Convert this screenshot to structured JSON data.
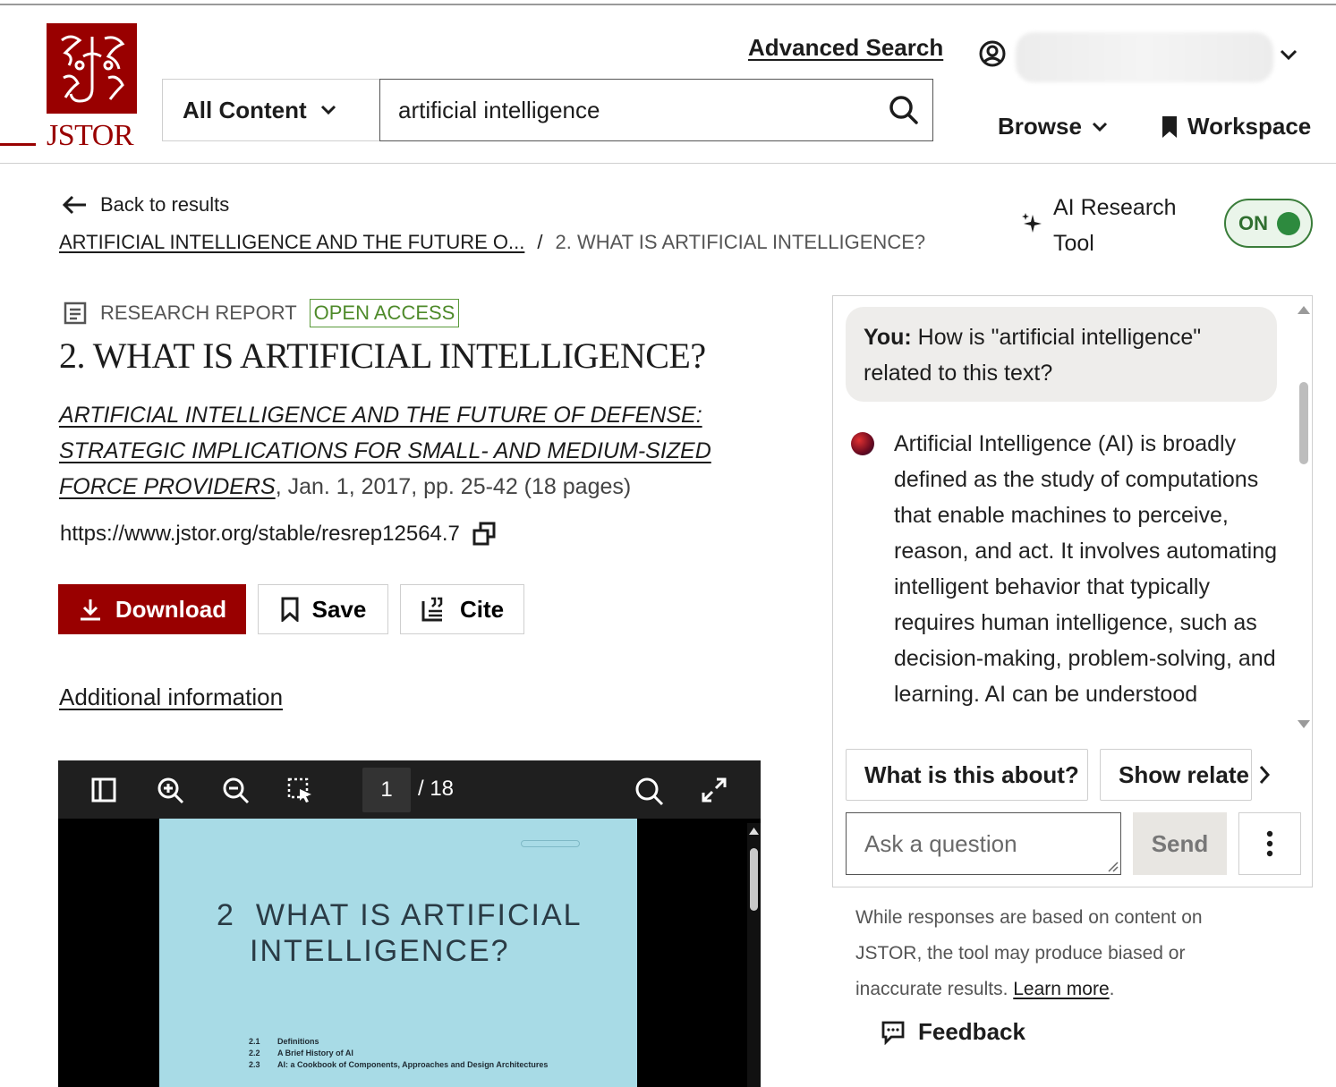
{
  "header": {
    "logo_text": "JSTOR",
    "advanced_search": "Advanced Search",
    "content_filter": "All Content",
    "search_value": "artificial intelligence",
    "browse": "Browse",
    "workspace": "Workspace"
  },
  "nav": {
    "back": "Back to results",
    "breadcrumb_parent": "ARTIFICIAL INTELLIGENCE AND THE FUTURE O...",
    "breadcrumb_sep": "/",
    "breadcrumb_current": "2. WHAT IS ARTIFICIAL INTELLIGENCE?"
  },
  "ai_tool": {
    "label_line1": "AI Research",
    "label_line2": "Tool",
    "toggle": "ON"
  },
  "article": {
    "type": "RESEARCH REPORT",
    "access": "OPEN ACCESS",
    "title": "2. WHAT IS ARTIFICIAL INTELLIGENCE?",
    "source_title": "ARTIFICIAL INTELLIGENCE AND THE FUTURE OF DEFENSE: STRATEGIC IMPLICATIONS FOR SMALL- AND MEDIUM-SIZED FORCE PROVIDERS",
    "source_meta": ", Jan. 1, 2017, pp. 25-42 (18 pages)",
    "stable_url": "https://www.jstor.org/stable/resrep12564.7"
  },
  "actions": {
    "download": "Download",
    "save": "Save",
    "cite": "Cite",
    "additional_info": "Additional information"
  },
  "viewer": {
    "current_page": "1",
    "total_pages": "/ 18",
    "page_title_num": "2",
    "page_title_line1": "WHAT IS ARTIFICIAL",
    "page_title_line2": "INTELLIGENCE?",
    "toc": [
      {
        "num": "2.1",
        "text": "Definitions"
      },
      {
        "num": "2.2",
        "text": "A Brief History of AI"
      },
      {
        "num": "2.3",
        "text": "AI: a Cookbook of Components, Approaches and Design Architectures"
      }
    ]
  },
  "chat": {
    "you_label": "You:",
    "you_question": " How is \"artificial intelligence\" related to this text?",
    "answer": "Artificial Intelligence (AI) is broadly defined as the study of computations that enable machines to perceive, reason, and act. It involves automating intelligent behavior that typically requires human intelligence, such as decision-making, problem-solving, and learning. AI can be understood",
    "chip_1": "What is this about?",
    "chip_2": "Show relate",
    "ask_placeholder": "Ask a question",
    "send": "Send",
    "disclaimer": "While responses are based on content on JSTOR, the tool may produce biased or inaccurate results. ",
    "learn_more": "Learn more",
    "disclaimer_end": ".",
    "feedback": "Feedback"
  },
  "colors": {
    "brand_red": "#990000",
    "toggle_green": "#2d8a3e",
    "viewer_bg": "#1f1f1f",
    "pdf_page": "#a8dbe6"
  }
}
